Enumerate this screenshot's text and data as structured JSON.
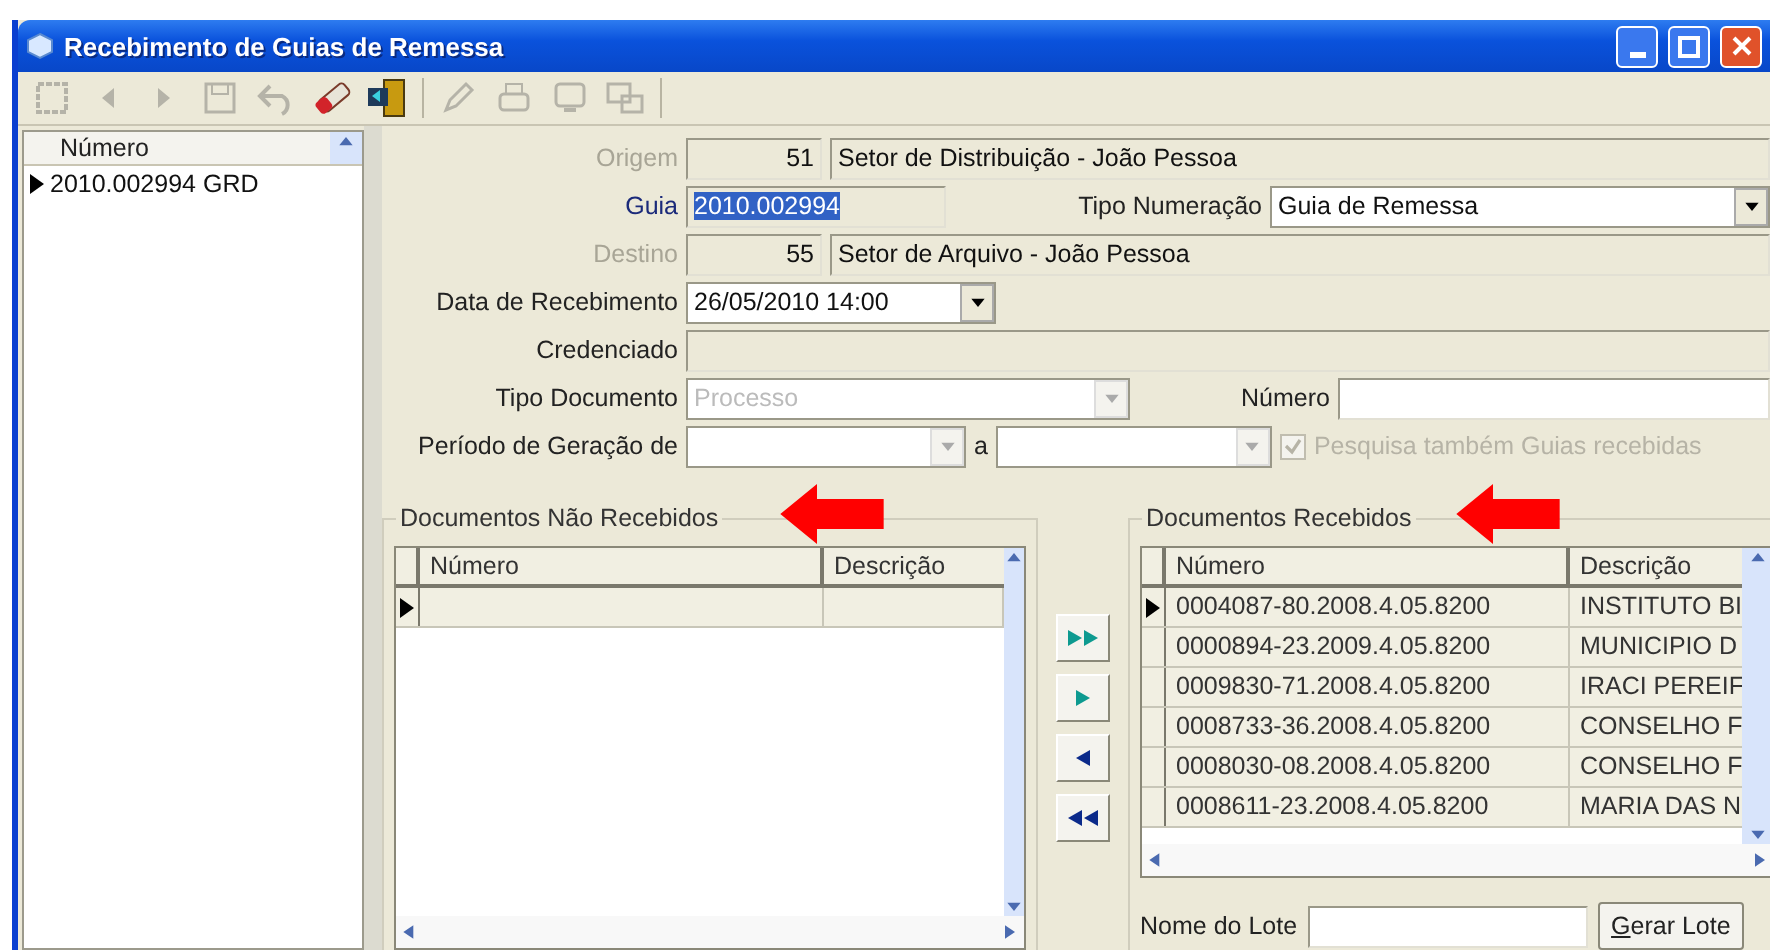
{
  "window": {
    "title": "Recebimento de Guias de Remessa"
  },
  "toolbar": [
    {
      "kind": "frame",
      "disabled": true
    },
    {
      "kind": "prev",
      "disabled": true
    },
    {
      "kind": "next",
      "disabled": true
    },
    {
      "kind": "save",
      "disabled": true
    },
    {
      "kind": "undo",
      "disabled": true
    },
    {
      "kind": "eraser",
      "disabled": false
    },
    {
      "kind": "exit",
      "disabled": false
    },
    {
      "kind": "edit",
      "disabled": true
    },
    {
      "kind": "print",
      "disabled": true
    },
    {
      "kind": "screen",
      "disabled": true
    },
    {
      "kind": "copy",
      "disabled": true
    }
  ],
  "sidebar": {
    "column": "Número",
    "items": [
      {
        "label": "2010.002994 GRD",
        "selected": true
      }
    ]
  },
  "form": {
    "origem": {
      "label": "Origem",
      "code": "51",
      "value": "Setor de Distribuição - João Pessoa",
      "disabled": true
    },
    "guia": {
      "label": "Guia",
      "value": "2010.002994",
      "selected": true
    },
    "tipo_numeracao": {
      "label": "Tipo Numeração",
      "value": "Guia de Remessa"
    },
    "destino": {
      "label": "Destino",
      "code": "55",
      "value": "Setor de Arquivo - João Pessoa",
      "disabled": true
    },
    "data_recebimento": {
      "label": "Data de Recebimento",
      "value": "26/05/2010 14:00"
    },
    "credenciado": {
      "label": "Credenciado"
    },
    "tipo_documento": {
      "label": "Tipo Documento",
      "value": "Processo",
      "disabled": true
    },
    "numero": {
      "label": "Número"
    },
    "periodo": {
      "label": "Período de Geração de",
      "separator": "a"
    },
    "pesquisa": {
      "label": "Pesquisa também Guias recebidas",
      "checked": true,
      "disabled": true
    }
  },
  "nao_recebidos": {
    "title": "Documentos Não Recebidos",
    "columns": [
      "Número",
      "Descrição"
    ]
  },
  "transfer_buttons": [
    {
      "kind": "all-right"
    },
    {
      "kind": "right"
    },
    {
      "kind": "left"
    },
    {
      "kind": "all-left"
    }
  ],
  "recebidos": {
    "title": "Documentos Recebidos",
    "columns": [
      "Número",
      "Descrição"
    ],
    "rows": [
      {
        "numero": "0004087-80.2008.4.05.8200",
        "descricao": "INSTITUTO BI",
        "current": true
      },
      {
        "numero": "0000894-23.2009.4.05.8200",
        "descricao": "MUNICIPIO D",
        "current": false
      },
      {
        "numero": "0009830-71.2008.4.05.8200",
        "descricao": "IRACI PEREIF",
        "current": false
      },
      {
        "numero": "0008733-36.2008.4.05.8200",
        "descricao": "CONSELHO F",
        "current": false
      },
      {
        "numero": "0008030-08.2008.4.05.8200",
        "descricao": "CONSELHO F",
        "current": false
      },
      {
        "numero": "0008611-23.2008.4.05.8200",
        "descricao": "MARIA DAS N",
        "current": false
      }
    ]
  },
  "lote": {
    "label": "Nome do Lote",
    "button": "Gerar Lote"
  }
}
